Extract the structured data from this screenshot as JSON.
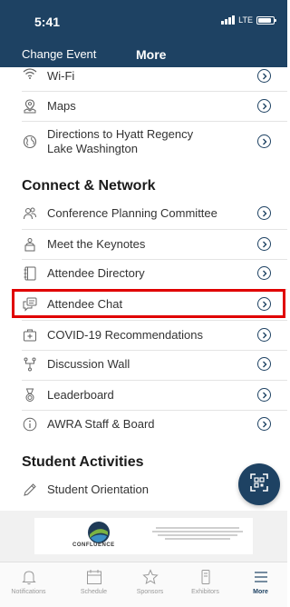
{
  "status_bar": {
    "time": "5:41",
    "network": "LTE",
    "battery_level": 0.85
  },
  "nav": {
    "back_label": "Change Event",
    "title": "More"
  },
  "items_top": [
    {
      "label": "Wi-Fi",
      "icon": "wifi-icon"
    },
    {
      "label": "Maps",
      "icon": "map-icon"
    },
    {
      "label_line1": "Directions to Hyatt Regency",
      "label_line2": "Lake Washington",
      "icon": "globe-icon"
    }
  ],
  "section_connect": {
    "title": "Connect & Network",
    "items": [
      {
        "label": "Conference Planning Committee",
        "icon": "people-icon"
      },
      {
        "label": "Meet the Keynotes",
        "icon": "speaker-icon"
      },
      {
        "label": "Attendee Directory",
        "icon": "directory-icon"
      },
      {
        "label": "Attendee Chat",
        "icon": "chat-icon"
      },
      {
        "label": "COVID-19 Recommendations",
        "icon": "medical-kit-icon"
      },
      {
        "label": "Discussion Wall",
        "icon": "discussion-icon"
      },
      {
        "label": "Leaderboard",
        "icon": "medal-icon"
      },
      {
        "label": "AWRA Staff & Board",
        "icon": "info-icon"
      }
    ]
  },
  "section_student": {
    "title": "Student Activities",
    "items": [
      {
        "label": "Student Orientation",
        "icon": "pencil-icon"
      }
    ]
  },
  "banner": {
    "name": "CONFLUENCE"
  },
  "tabs": [
    {
      "label": "Notifications",
      "icon": "bell-icon"
    },
    {
      "label": "Schedule",
      "icon": "calendar-icon"
    },
    {
      "label": "Sponsors",
      "icon": "star-icon"
    },
    {
      "label": "Exhibitors",
      "icon": "exhibitor-icon"
    },
    {
      "label": "More",
      "icon": "menu-icon",
      "active": true
    }
  ],
  "colors": {
    "header": "#1e4263",
    "highlight": "#e00000",
    "accent": "#1e4263"
  }
}
